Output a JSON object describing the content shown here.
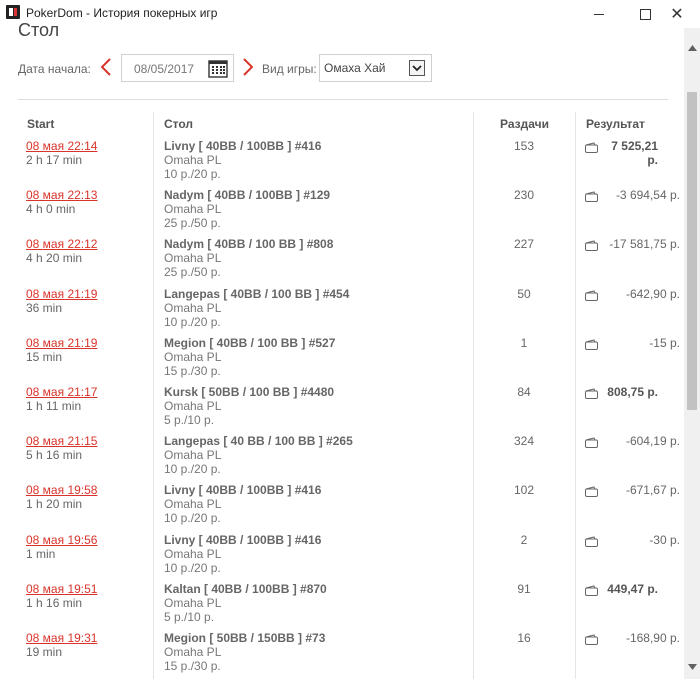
{
  "window": {
    "title": "PokerDom - История покерных игр",
    "close_glyph": "✕"
  },
  "section_title": "Стол",
  "filters": {
    "date_label": "Дата начала:",
    "date_value": "08/05/2017",
    "game_label": "Вид игры:",
    "game_value": "Омаха Хай"
  },
  "columns": {
    "start": "Start",
    "table": "Стол",
    "hands": "Раздачи",
    "result": "Результат"
  },
  "rows": [
    {
      "date": "08 мая 22:14",
      "duration": "2 h 17 min",
      "table": "Livny [ 40BB / 100BB ] #416",
      "game": "Omaha PL",
      "stakes": "10 р./20 р.",
      "hands": "153",
      "result": "7 525,21 р.",
      "positive": true
    },
    {
      "date": "08 мая 22:13",
      "duration": "4 h 0 min",
      "table": "Nadym [ 40BB / 100BB ] #129",
      "game": "Omaha PL",
      "stakes": "25 р./50 р.",
      "hands": "230",
      "result": "-3 694,54 р.",
      "positive": false
    },
    {
      "date": "08 мая 22:12",
      "duration": "4 h 20 min",
      "table": "Nadym [ 40BB / 100 BB ] #808",
      "game": "Omaha PL",
      "stakes": "25 р./50 р.",
      "hands": "227",
      "result": "-17 581,75 р.",
      "positive": false
    },
    {
      "date": "08 мая 21:19",
      "duration": "36 min",
      "table": "Langepas [ 40BB / 100 BB ] #454",
      "game": "Omaha PL",
      "stakes": "10 р./20 р.",
      "hands": "50",
      "result": "-642,90 р.",
      "positive": false
    },
    {
      "date": "08 мая 21:19",
      "duration": "15 min",
      "table": "Megion [ 40BB / 100 BB ] #527",
      "game": "Omaha PL",
      "stakes": "15 р./30 р.",
      "hands": "1",
      "result": "-15 р.",
      "positive": false
    },
    {
      "date": "08 мая 21:17",
      "duration": "1 h 11 min",
      "table": "Kursk [ 50BB / 100 BB ] #4480",
      "game": "Omaha PL",
      "stakes": "5 р./10 р.",
      "hands": "84",
      "result": "808,75 р.",
      "positive": true
    },
    {
      "date": "08 мая 21:15",
      "duration": "5 h 16 min",
      "table": "Langepas [ 40 BB / 100 BB ] #265",
      "game": "Omaha PL",
      "stakes": "10 р./20 р.",
      "hands": "324",
      "result": "-604,19 р.",
      "positive": false
    },
    {
      "date": "08 мая 19:58",
      "duration": "1 h 20 min",
      "table": "Livny [ 40BB / 100BB ] #416",
      "game": "Omaha PL",
      "stakes": "10 р./20 р.",
      "hands": "102",
      "result": "-671,67 р.",
      "positive": false
    },
    {
      "date": "08 мая 19:56",
      "duration": "1 min",
      "table": "Livny [ 40BB / 100BB ] #416",
      "game": "Omaha PL",
      "stakes": "10 р./20 р.",
      "hands": "2",
      "result": "-30 р.",
      "positive": false
    },
    {
      "date": "08 мая 19:51",
      "duration": "1 h 16 min",
      "table": "Kaltan [ 40BB / 100BB ] #870",
      "game": "Omaha PL",
      "stakes": "5 р./10 р.",
      "hands": "91",
      "result": "449,47 р.",
      "positive": true
    },
    {
      "date": "08 мая 19:31",
      "duration": "19 min",
      "table": "Megion [ 50BB / 150BB ] #73",
      "game": "Omaha PL",
      "stakes": "15 р./30 р.",
      "hands": "16",
      "result": "-168,90 р.",
      "positive": false
    }
  ],
  "colors": {
    "accent": "#d9342b",
    "text": "#555555",
    "border": "#d0d0d0",
    "scroll_thumb": "#c2c2c2"
  },
  "icons": [
    "app-logo-icon",
    "prev-arrow-icon",
    "next-arrow-icon",
    "calendar-icon",
    "dropdown-chevron-icon",
    "wallet-icon"
  ]
}
